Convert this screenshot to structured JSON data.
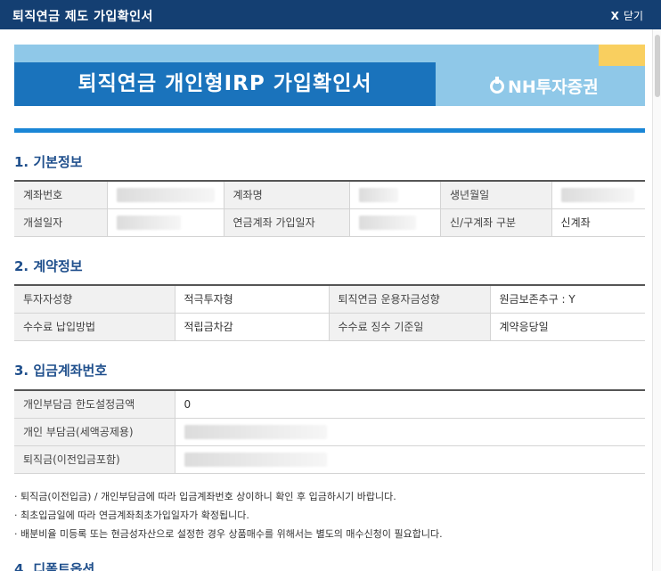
{
  "window": {
    "title": "퇴직연금 제도 가입확인서",
    "close_icon": "X",
    "close_label": "닫기"
  },
  "banner": {
    "title": "퇴직연금 개인형IRP 가입확인서",
    "brand": "NH투자증권",
    "colors": {
      "light": "#8fc8e8",
      "blue": "#1a73bc",
      "accent": "#f9cf5f"
    }
  },
  "sections": {
    "basic": {
      "title": "1. 기본정보",
      "rows": [
        {
          "l1": "계좌번호",
          "v1": "",
          "l2": "계좌명",
          "v2": "",
          "l3": "생년월일",
          "v3": ""
        },
        {
          "l1": "개설일자",
          "v1": "",
          "l2": "연금계좌 가입일자",
          "v2": "",
          "l3": "신/구계좌 구분",
          "v3": "신계좌"
        }
      ]
    },
    "contract": {
      "title": "2. 계약정보",
      "rows": [
        {
          "l1": "투자자성향",
          "v1": "적극투자형",
          "l2": "퇴직연금 운용자금성향",
          "v2": "원금보존추구 : Y"
        },
        {
          "l1": "수수료 납입방법",
          "v1": "적립금차감",
          "l2": "수수료 징수 기준일",
          "v2": "계약응당일"
        }
      ]
    },
    "deposit": {
      "title": "3. 입금계좌번호",
      "rows": [
        {
          "label": "개인부담금 한도설정금액",
          "value": "0"
        },
        {
          "label": "개인 부담금(세액공제용)",
          "value": ""
        },
        {
          "label": "퇴직금(이전입금포함)",
          "value": ""
        }
      ]
    },
    "next": {
      "title": "4. 디폴트옵션"
    }
  },
  "notes": [
    "퇴직금(이전입금) / 개인부담금에 따라 입금계좌번호 상이하니 확인 후 입금하시기 바랍니다.",
    "최초입금일에 따라 연금계좌최초가입일자가 확정됩니다.",
    "배분비율 미등록 또는 현금성자산으로 설정한 경우 상품매수를 위해서는 별도의 매수신청이 필요합니다."
  ]
}
